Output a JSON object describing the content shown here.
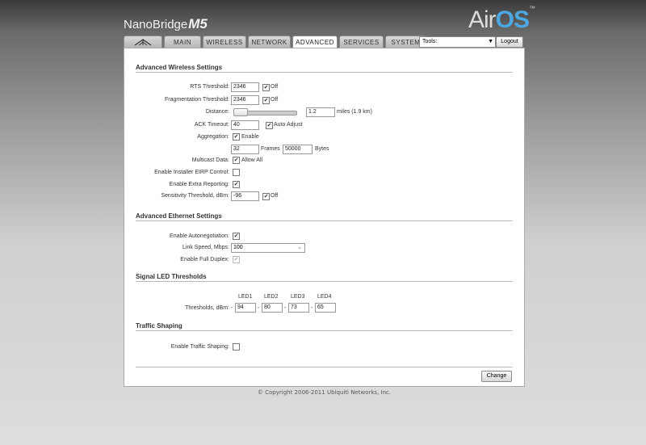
{
  "brand": {
    "product": "NanoBridge",
    "model": "M5",
    "os_prefix": "Air",
    "os_suffix": "OS",
    "tm": "™"
  },
  "tabs": [
    {
      "label": ""
    },
    {
      "label": "MAIN"
    },
    {
      "label": "WIRELESS"
    },
    {
      "label": "NETWORK"
    },
    {
      "label": "ADVANCED"
    },
    {
      "label": "SERVICES"
    },
    {
      "label": "SYSTEM"
    }
  ],
  "header": {
    "tools_value": "Tools:",
    "logout_label": "Logout"
  },
  "wireless": {
    "title": "Advanced Wireless Settings",
    "rts_label": "RTS Threshold:",
    "rts_value": "2346",
    "rts_off": "Off",
    "frag_label": "Fragmentation Threshold:",
    "frag_value": "2346",
    "frag_off": "Off",
    "distance_label": "Distance:",
    "distance_value": "1.2",
    "distance_unit": "miles (1.9 km)",
    "ack_label": "ACK Timeout:",
    "ack_value": "40",
    "ack_auto": "Auto Adjust",
    "agg_label": "Aggregation:",
    "agg_enable": "Enable",
    "agg_frames_value": "32",
    "agg_frames_label": "Frames",
    "agg_bytes_value": "50000",
    "agg_bytes_label": "Bytes",
    "multicast_label": "Multicast Data:",
    "multicast_allow": "Allow All",
    "eirp_label": "Enable Installer EIRP Control:",
    "extra_label": "Enable Extra Reporting:",
    "sens_label": "Sensitivity Threshold, dBm:",
    "sens_value": "-96",
    "sens_off": "Off"
  },
  "ethernet": {
    "title": "Advanced Ethernet Settings",
    "autoneg_label": "Enable Autonegotiation:",
    "speed_label": "Link Speed, Mbps:",
    "speed_value": "100",
    "duplex_label": "Enable Full Duplex:"
  },
  "led": {
    "title": "Signal LED Thresholds",
    "headers": [
      "LED1",
      "LED2",
      "LED3",
      "LED4"
    ],
    "thresholds_label": "Thresholds, dBm:",
    "dash": "-",
    "values": [
      "94",
      "80",
      "73",
      "65"
    ]
  },
  "shaping": {
    "title": "Traffic Shaping",
    "enable_label": "Enable Traffic Shaping:"
  },
  "footer": {
    "change_label": "Change",
    "copyright": "© Copyright 2006-2011 Ubiquiti Networks, Inc."
  }
}
